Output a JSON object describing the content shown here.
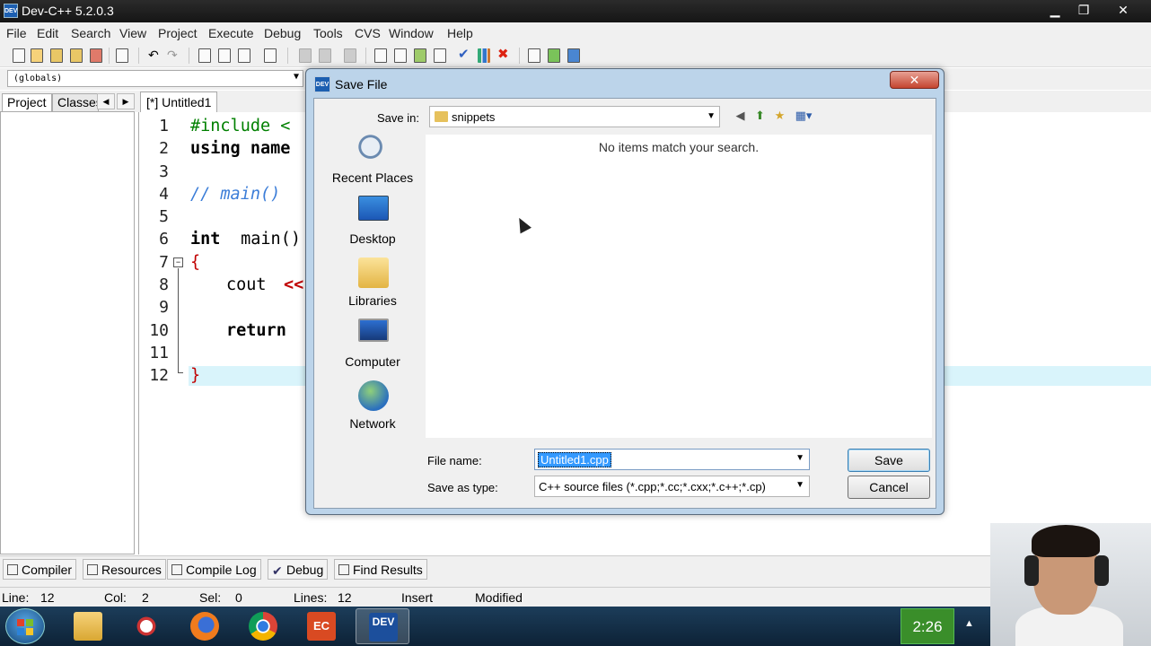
{
  "window": {
    "title": "Dev-C++ 5.2.0.3",
    "icon": "dev-cpp-icon",
    "icon_text": "DEV",
    "controls": [
      "minimize",
      "maximize",
      "close"
    ]
  },
  "menu": [
    "File",
    "Edit",
    "Search",
    "View",
    "Project",
    "Execute",
    "Debug",
    "Tools",
    "CVS",
    "Window",
    "Help"
  ],
  "scope_combo": "(globals)",
  "left_tabs": {
    "project": "Project",
    "classes": "Classes"
  },
  "editor": {
    "tab": "[*] Untitled1",
    "line_numbers": [
      "1",
      "2",
      "3",
      "4",
      "5",
      "6",
      "7",
      "8",
      "9",
      "10",
      "11",
      "12"
    ],
    "visible_code": {
      "l1": "#include <",
      "l2": "using name",
      "l4": "// main()",
      "l6_kw": "int",
      "l6_rest": " main()",
      "l7": "{",
      "l8_a": "cout ",
      "l8_b": "<<",
      "l10": "return",
      "l12": "}"
    }
  },
  "bottom_tabs": [
    "Compiler",
    "Resources",
    "Compile Log",
    "Debug",
    "Find Results"
  ],
  "status": {
    "line_label": "Line:",
    "line_value": "12",
    "col_label": "Col:",
    "col_value": "2",
    "sel_label": "Sel:",
    "sel_value": "0",
    "lines_label": "Lines:",
    "lines_value": "12",
    "mode": "Insert",
    "modified": "Modified"
  },
  "taskbar": {
    "clock": "2:26",
    "apps": [
      "windows-explorer",
      "snipping-tool",
      "firefox",
      "chrome",
      "dev-cpp-ec",
      "dev-cpp"
    ],
    "dev_cpp_label": "DEV",
    "ec_label": "EC"
  },
  "dialog": {
    "title": "Save File",
    "save_in_label": "Save in:",
    "save_in_value": "snippets",
    "places": [
      "Recent Places",
      "Desktop",
      "Libraries",
      "Computer",
      "Network"
    ],
    "empty_message": "No items match your search.",
    "file_name_label": "File name:",
    "file_name_value": "Untitled1.cpp",
    "save_as_type_label": "Save as type:",
    "save_as_type_value": "C++ source files (*.cpp;*.cc;*.cxx;*.c++;*.cp)",
    "save_button": "Save",
    "cancel_button": "Cancel",
    "close_glyph": "✕"
  },
  "colors": {
    "code_keyword": "#000000",
    "preprocessor": "#008000",
    "comment": "#3b7dd8",
    "operator": "#c00000",
    "current_line": "#d9f4fb",
    "dialog_frame": "#bcd4ea"
  }
}
